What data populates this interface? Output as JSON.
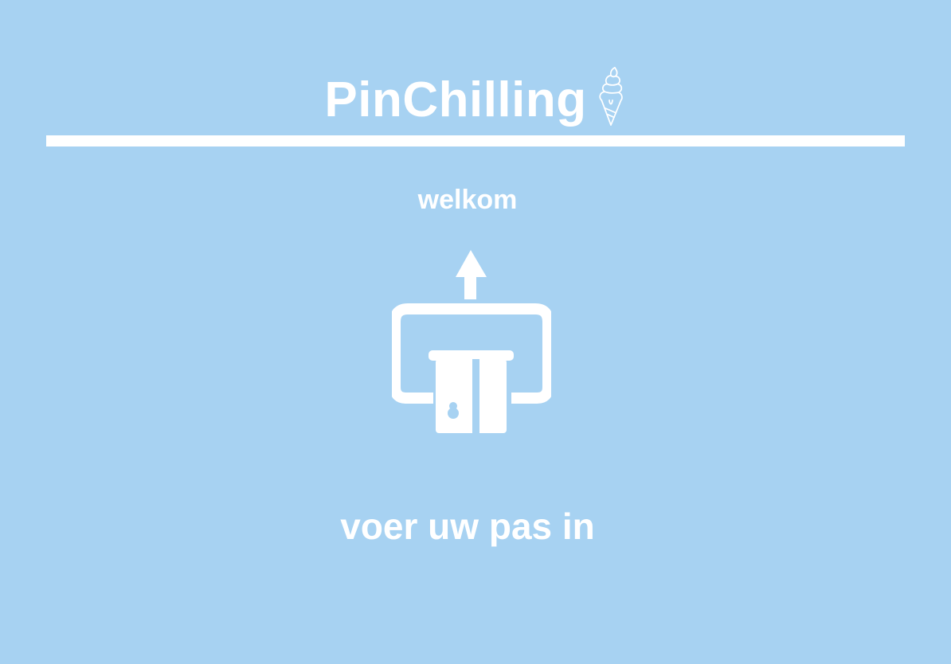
{
  "app": {
    "title": "PinChilling",
    "logo_icon": "ice-cream-cone-icon"
  },
  "screen": {
    "greeting": "welkom",
    "instruction": "voer uw pas in",
    "illustration_icon": "insert-card-icon"
  },
  "colors": {
    "background": "#a7d2f2",
    "foreground": "#ffffff"
  }
}
